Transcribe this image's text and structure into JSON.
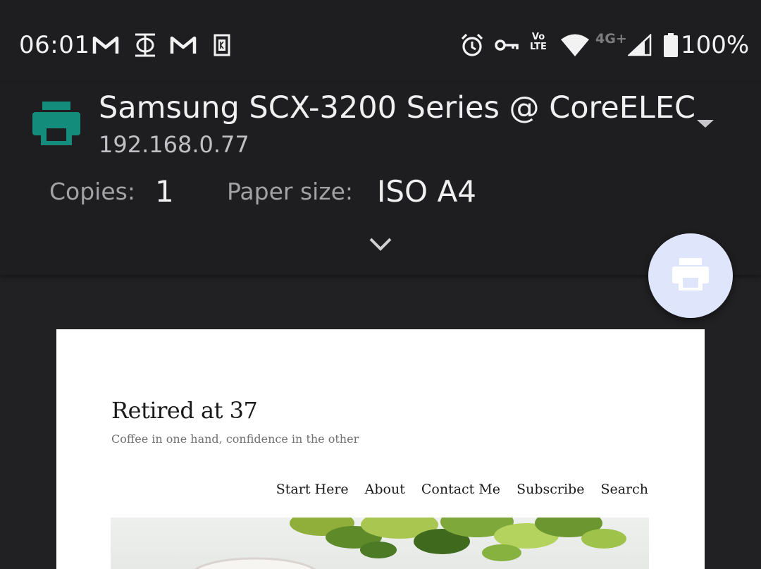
{
  "status_bar": {
    "time": "06:01",
    "network_type": "4G+",
    "volte": {
      "line1": "Vo",
      "line2": "LTE"
    },
    "battery_percent": "100%",
    "left_icons": [
      "gmail-icon",
      "phi-app-icon",
      "gmail-icon",
      "k-app-icon"
    ],
    "right_icons": [
      "alarm-icon",
      "vpn-key-icon",
      "volte-icon",
      "wifi-icon",
      "signal-icon",
      "battery-icon"
    ]
  },
  "printer": {
    "name": "Samsung SCX-3200 Series @ CoreELEC",
    "address": "192.168.0.77",
    "icon": "printer-icon",
    "icon_color": "#138c7c"
  },
  "options": {
    "copies_label": "Copies:",
    "copies_value": "1",
    "paper_size_label": "Paper size:",
    "paper_size_value": "ISO A4"
  },
  "fab": {
    "icon": "print-icon",
    "color": "#dfe5fb"
  },
  "preview": {
    "site_title": "Retired at 37",
    "tagline": "Coffee in one hand, confidence in the other",
    "nav": [
      "Start Here",
      "About",
      "Contact Me",
      "Subscribe",
      "Search"
    ]
  }
}
